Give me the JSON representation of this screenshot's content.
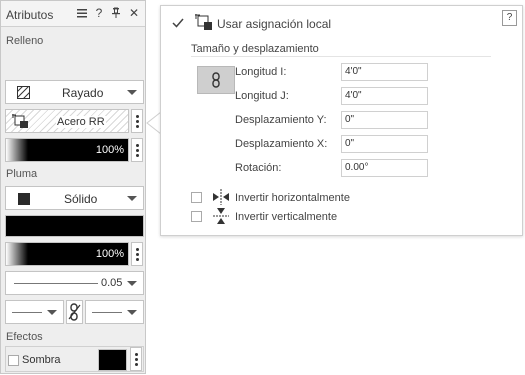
{
  "panel": {
    "title": "Atributos",
    "header_icons": [
      "hamburger-icon",
      "help-icon",
      "pin-icon",
      "close-icon"
    ],
    "help_glyph": "?",
    "close_glyph": "✕",
    "fill": {
      "section_label": "Relleno",
      "type_label": "Rayado",
      "pattern_label": "Acero RR",
      "opacity_value": "100%"
    },
    "pen": {
      "section_label": "Pluma",
      "type_label": "Sólido",
      "opacity_value": "100%",
      "line_weight": "0.05"
    },
    "effects": {
      "section_label": "Efectos",
      "shadow_label": "Sombra"
    }
  },
  "popup": {
    "help_glyph": "?",
    "local_mapping_label": "Usar asignación local",
    "local_mapping_checked": true,
    "section_title": "Tamaño y desplazamiento",
    "fields": [
      {
        "label": "Longitud I:",
        "value": "4'0\""
      },
      {
        "label": "Longitud J:",
        "value": "4'0\""
      },
      {
        "label": "Desplazamiento Y:",
        "value": "0\""
      },
      {
        "label": "Desplazamiento X:",
        "value": "0\""
      },
      {
        "label": "Rotación:",
        "value": "0.00°"
      }
    ],
    "flip_horizontal_label": "Invertir horizontalmente",
    "flip_vertical_label": "Invertir verticalmente"
  },
  "colors": {
    "accent_link_button": "#cfcfcf",
    "swatch_dark": "#2a2a2a",
    "panel_bg": "#eeeeee"
  }
}
